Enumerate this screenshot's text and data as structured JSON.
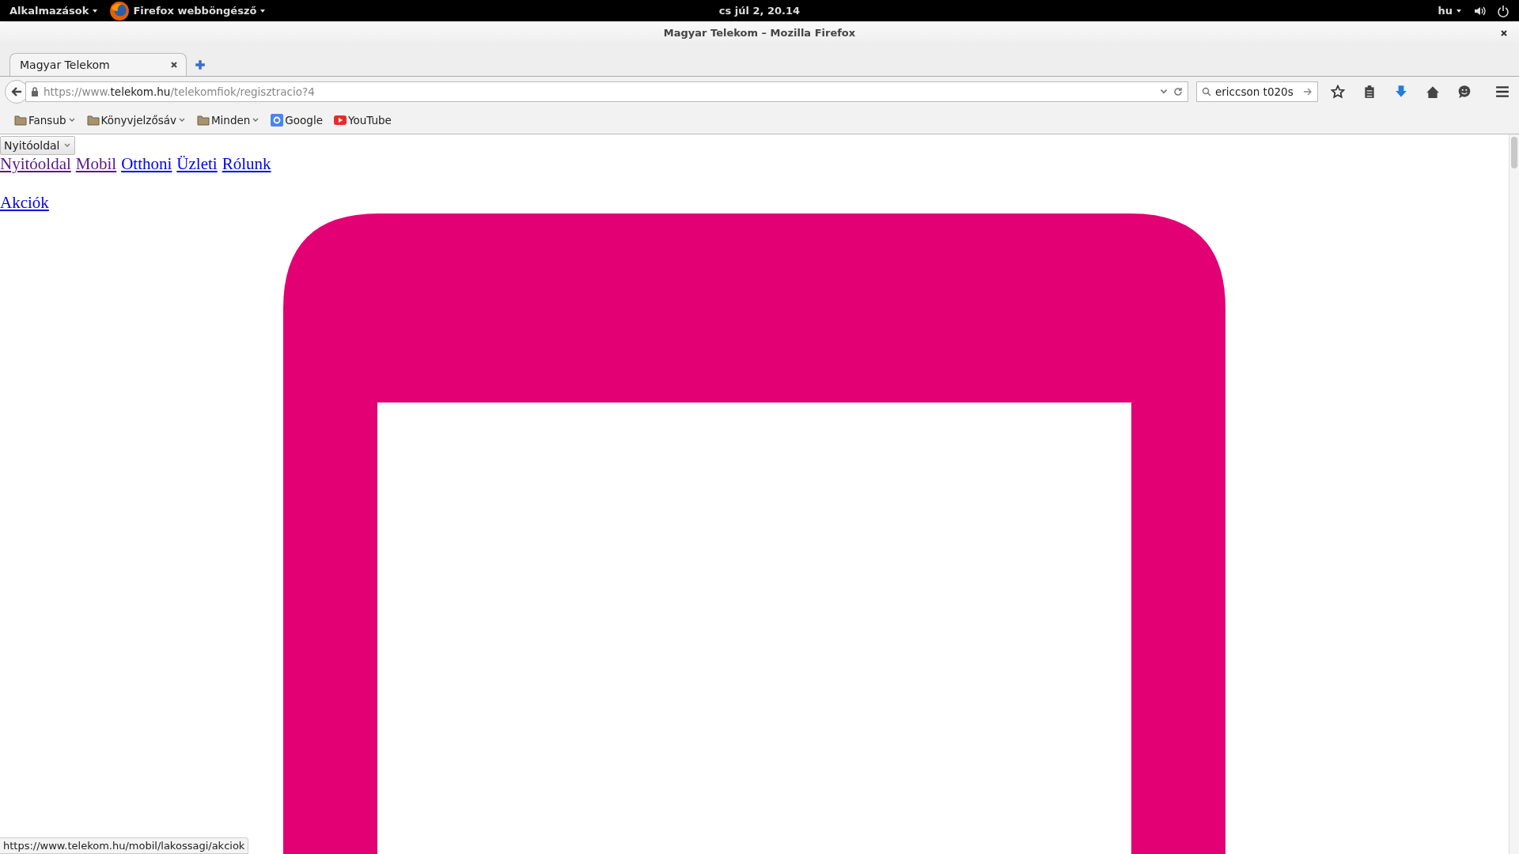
{
  "top_bar": {
    "apps_menu": "Alkalmazások",
    "app_menu": "Firefox webböngésző",
    "clock": "cs júl  2, 20.14",
    "language": "hu"
  },
  "window": {
    "title": "Magyar Telekom – Mozilla Firefox"
  },
  "tabs": [
    {
      "label": "Magyar Telekom",
      "selected": true
    }
  ],
  "address_bar": {
    "scheme": "https://www.",
    "domain": "telekom.hu",
    "path": "/telekomfiok/regisztracio?4"
  },
  "search": {
    "value": "ericcson t020s"
  },
  "bookmarks": [
    {
      "label": "Fansub",
      "kind": "folder"
    },
    {
      "label": "Könyvjelzősáv",
      "kind": "folder"
    },
    {
      "label": "Minden",
      "kind": "folder"
    },
    {
      "label": "Google",
      "kind": "google"
    },
    {
      "label": "YouTube",
      "kind": "youtube"
    }
  ],
  "page": {
    "select": "Nyitóoldal",
    "nav_links": [
      {
        "label": "Nyitóoldal",
        "visited": true
      },
      {
        "label": "Mobil",
        "visited": true
      },
      {
        "label": "Otthoni",
        "visited": false
      },
      {
        "label": "Üzleti",
        "visited": false
      },
      {
        "label": "Rólunk",
        "visited": false
      }
    ],
    "promo_link": "Akciók"
  },
  "status_bar": "https://www.telekom.hu/mobil/lakossagi/akciok"
}
